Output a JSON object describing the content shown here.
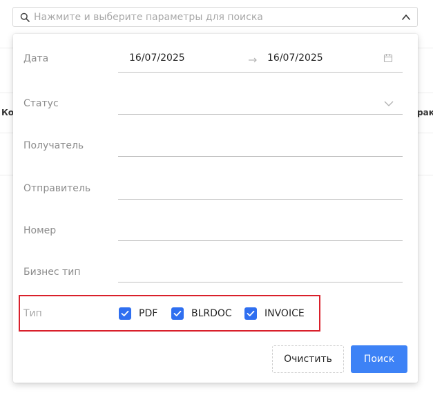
{
  "background": {
    "left_fragment": "Ко",
    "right_fragment": "ракт"
  },
  "search": {
    "placeholder": "Нажмите и выберите параметры для поиска"
  },
  "filters": {
    "date": {
      "label": "Дата",
      "from": "16/07/2025",
      "to": "16/07/2025"
    },
    "status": {
      "label": "Статус",
      "value": ""
    },
    "recipient": {
      "label": "Получатель",
      "value": ""
    },
    "sender": {
      "label": "Отправитель",
      "value": ""
    },
    "number": {
      "label": "Номер",
      "value": ""
    },
    "business_type": {
      "label": "Бизнес тип",
      "value": ""
    },
    "type": {
      "label": "Тип",
      "options": [
        {
          "label": "PDF",
          "checked": true
        },
        {
          "label": "BLRDOC",
          "checked": true
        },
        {
          "label": "INVOICE",
          "checked": true
        }
      ]
    }
  },
  "actions": {
    "clear_label": "Очистить",
    "search_label": "Поиск"
  },
  "colors": {
    "accent": "#3d82f6",
    "checkbox": "#2f6ff0",
    "highlight": "#d9202b"
  },
  "icons": {
    "search": "search-icon",
    "collapse": "chevron-up-icon",
    "calendar": "calendar-icon",
    "dropdown": "chevron-down-icon",
    "range": "arrow-right-icon",
    "check": "check-icon"
  }
}
